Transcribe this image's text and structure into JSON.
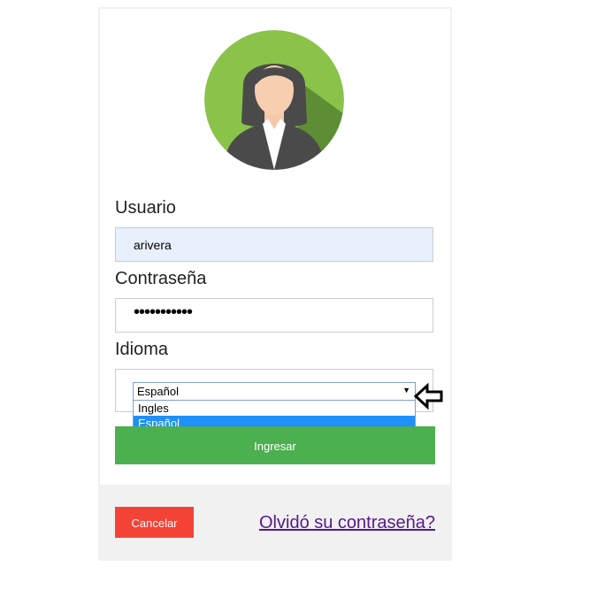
{
  "form": {
    "username_label": "Usuario",
    "username_value": "arivera",
    "password_label": "Contraseña",
    "password_value": "•••••••••••",
    "language_label": "Idioma",
    "language_selected": "Español",
    "language_options": [
      "Ingles",
      "Español"
    ],
    "submit_label": "Ingresar"
  },
  "footer": {
    "cancel_label": "Cancelar",
    "forgot_label": "Olvidó su contraseña?"
  },
  "icons": {
    "avatar": "avatar-icon",
    "caret": "caret-down-icon",
    "pointer": "left-arrow-pointer-icon"
  },
  "colors": {
    "avatar_bg": "#8bc34a",
    "submit": "#4caf50",
    "cancel": "#f44336",
    "autofill": "#e8f0fe",
    "link": "#551a8b",
    "option_highlight": "#1e90ff"
  }
}
